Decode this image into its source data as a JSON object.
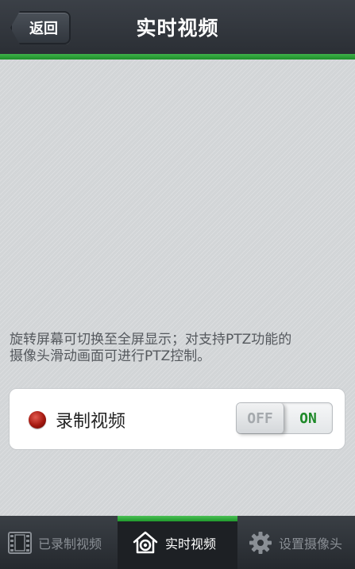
{
  "header": {
    "back_label": "返回",
    "title": "实时视频"
  },
  "content": {
    "hint_line1": "旋转屏幕可切换至全屏显示；对支持PTZ功能的",
    "hint_line2": "摄像头滑动画面可进行PTZ控制。",
    "record": {
      "label": "录制视频",
      "toggle_off": "OFF",
      "toggle_on": "ON",
      "state": "off"
    }
  },
  "tabs": [
    {
      "label": "已录制视频",
      "icon": "film-icon",
      "active": false
    },
    {
      "label": "实时视频",
      "icon": "home-camera-icon",
      "active": true
    },
    {
      "label": "设置摄像头",
      "icon": "gear-icon",
      "active": false
    }
  ],
  "colors": {
    "accent_green": "#2a9d35",
    "header_dark": "#2b2f35",
    "record_red": "#a3180f"
  }
}
